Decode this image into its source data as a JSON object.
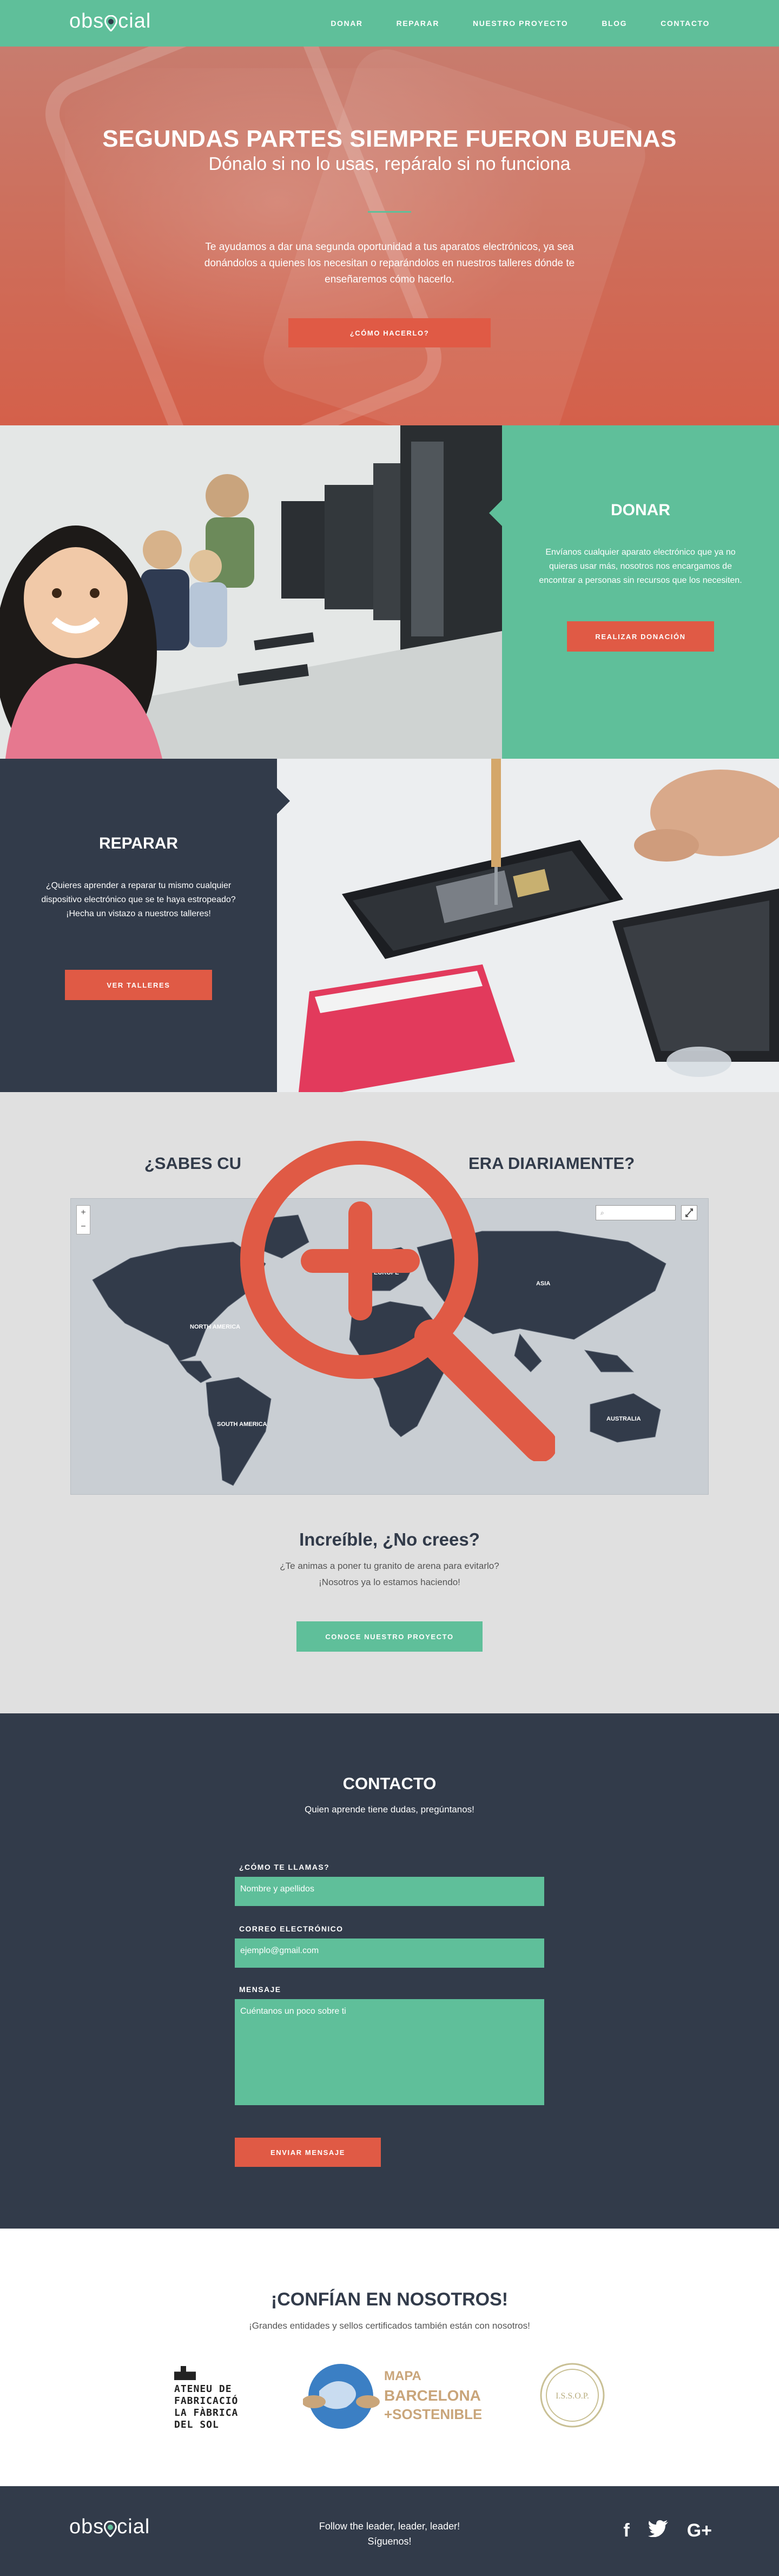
{
  "nav": {
    "logo": {
      "pre": "obs",
      "post": "cial"
    },
    "links": [
      "DONAR",
      "REPARAR",
      "NUESTRO PROYECTO",
      "BLOG",
      "CONTACTO"
    ]
  },
  "hero": {
    "title": "SEGUNDAS PARTES SIEMPRE FUERON BUENAS",
    "subtitle": "Dónalo si no lo usas, repáralo si no funciona",
    "text": "Te ayudamos a dar una segunda oportunidad a tus aparatos electrónicos, ya sea donándolos a quienes los necesitan o reparándolos en nuestros talleres dónde te enseñaremos cómo hacerlo.",
    "button": "¿CÓMO HACERLO?"
  },
  "donar": {
    "title": "DONAR",
    "text": "Envíanos cualquier aparato electrónico que ya no quieras usar más, nosotros nos encargamos de encontrar a personas sin recursos que los necesiten.",
    "button": "REALIZAR DONACIÓN"
  },
  "reparar": {
    "title": "REPARAR",
    "text": "¿Quieres aprender a reparar tu mismo cualquier dispositivo electrónico que se te haya estropeado? ¡Hecha un vistazo a nuestros talleres!",
    "button": "VER TALLERES"
  },
  "map_section": {
    "title_start": "¿SABES CU",
    "title_end": "ERA DIARIAMENTE?",
    "map": {
      "zoom_in": "+",
      "zoom_out": "−",
      "labels": [
        "NORTH AMERICA",
        "SOUTH AMERICA",
        "EUROPE",
        "AFRICA",
        "ASIA",
        "AUSTRALIA"
      ]
    },
    "heading": "Increíble, ¿No crees?",
    "text_line1": "¿Te animas a poner tu granito de arena para evitarlo?",
    "text_line2": "¡Nosotros ya lo estamos haciendo!",
    "button": "CONOCE NUESTRO PROYECTO"
  },
  "contact": {
    "title": "CONTACTO",
    "subtitle": "Quien aprende tiene dudas, pregúntanos!",
    "name_label": "¿CÓMO TE LLAMAS?",
    "name_placeholder": "Nombre y apellidos",
    "email_label": "CORREO ELECTRÓNICO",
    "email_placeholder": "ejemplo@gmail.com",
    "message_label": "MENSAJE",
    "message_placeholder": "Cuéntanos un poco sobre ti",
    "button": "ENVIAR MENSAJE"
  },
  "trust": {
    "title": "¡CONFÍAN EN NOSOTROS!",
    "subtitle": "¡Grandes entidades y sellos certificados también están con nosotros!",
    "ateneu": [
      "ATENEU DE",
      "FABRICACIÓ",
      "LA FÀBRICA",
      "DEL SOL"
    ],
    "mapa": [
      "MAPA",
      "BARCELONA",
      "+SOSTENIBLE"
    ],
    "issop": "I.S.S.O.P."
  },
  "footer": {
    "tagline_1": "Follow the leader, leader, leader!",
    "tagline_2": "Síguenos!",
    "social": [
      "f",
      "t",
      "G+"
    ]
  },
  "colors": {
    "green": "#5fbf9a",
    "navy": "#323b4a",
    "red": "#e05a45",
    "grey": "#e0e0e0"
  }
}
